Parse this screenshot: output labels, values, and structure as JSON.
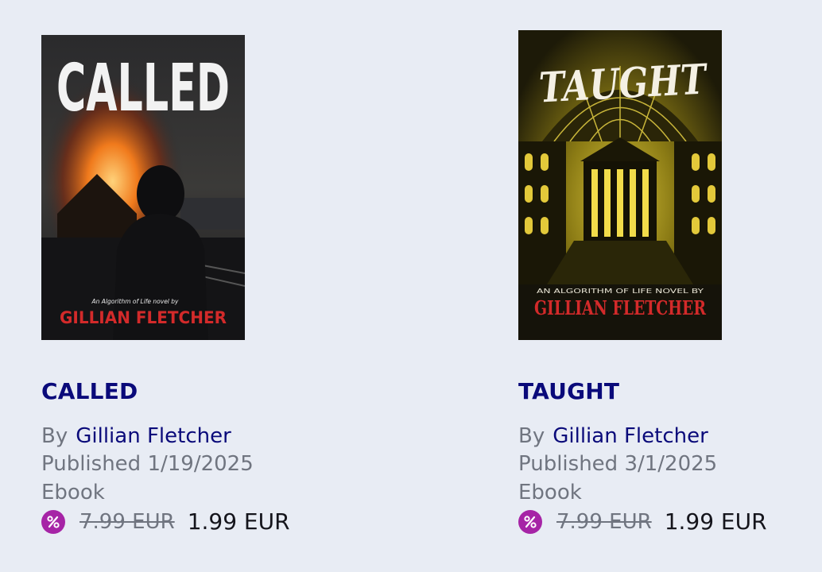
{
  "books": [
    {
      "title": "CALLED",
      "cover": {
        "title_text": "CALLED",
        "tagline": "An Algorithm of Life novel by",
        "author_text": "GILLIAN FLETCHER"
      },
      "by_label": "By",
      "author": "Gillian Fletcher",
      "published": "Published 1/19/2025",
      "format": "Ebook",
      "old_price": "7.99 EUR",
      "new_price": "1.99 EUR"
    },
    {
      "title": "TAUGHT",
      "cover": {
        "title_text": "TAUGHT",
        "tagline": "AN ALGORITHM OF LIFE NOVEL BY",
        "author_text": "GILLIAN FLETCHER"
      },
      "by_label": "By",
      "author": "Gillian Fletcher",
      "published": "Published 3/1/2025",
      "format": "Ebook",
      "old_price": "7.99 EUR",
      "new_price": "1.99 EUR"
    }
  ],
  "colors": {
    "background": "#e8ecf4",
    "link": "#0a0a7a",
    "muted": "#707580",
    "discount_badge": "#a624a6",
    "cover_author_red": "#d32a2a"
  }
}
